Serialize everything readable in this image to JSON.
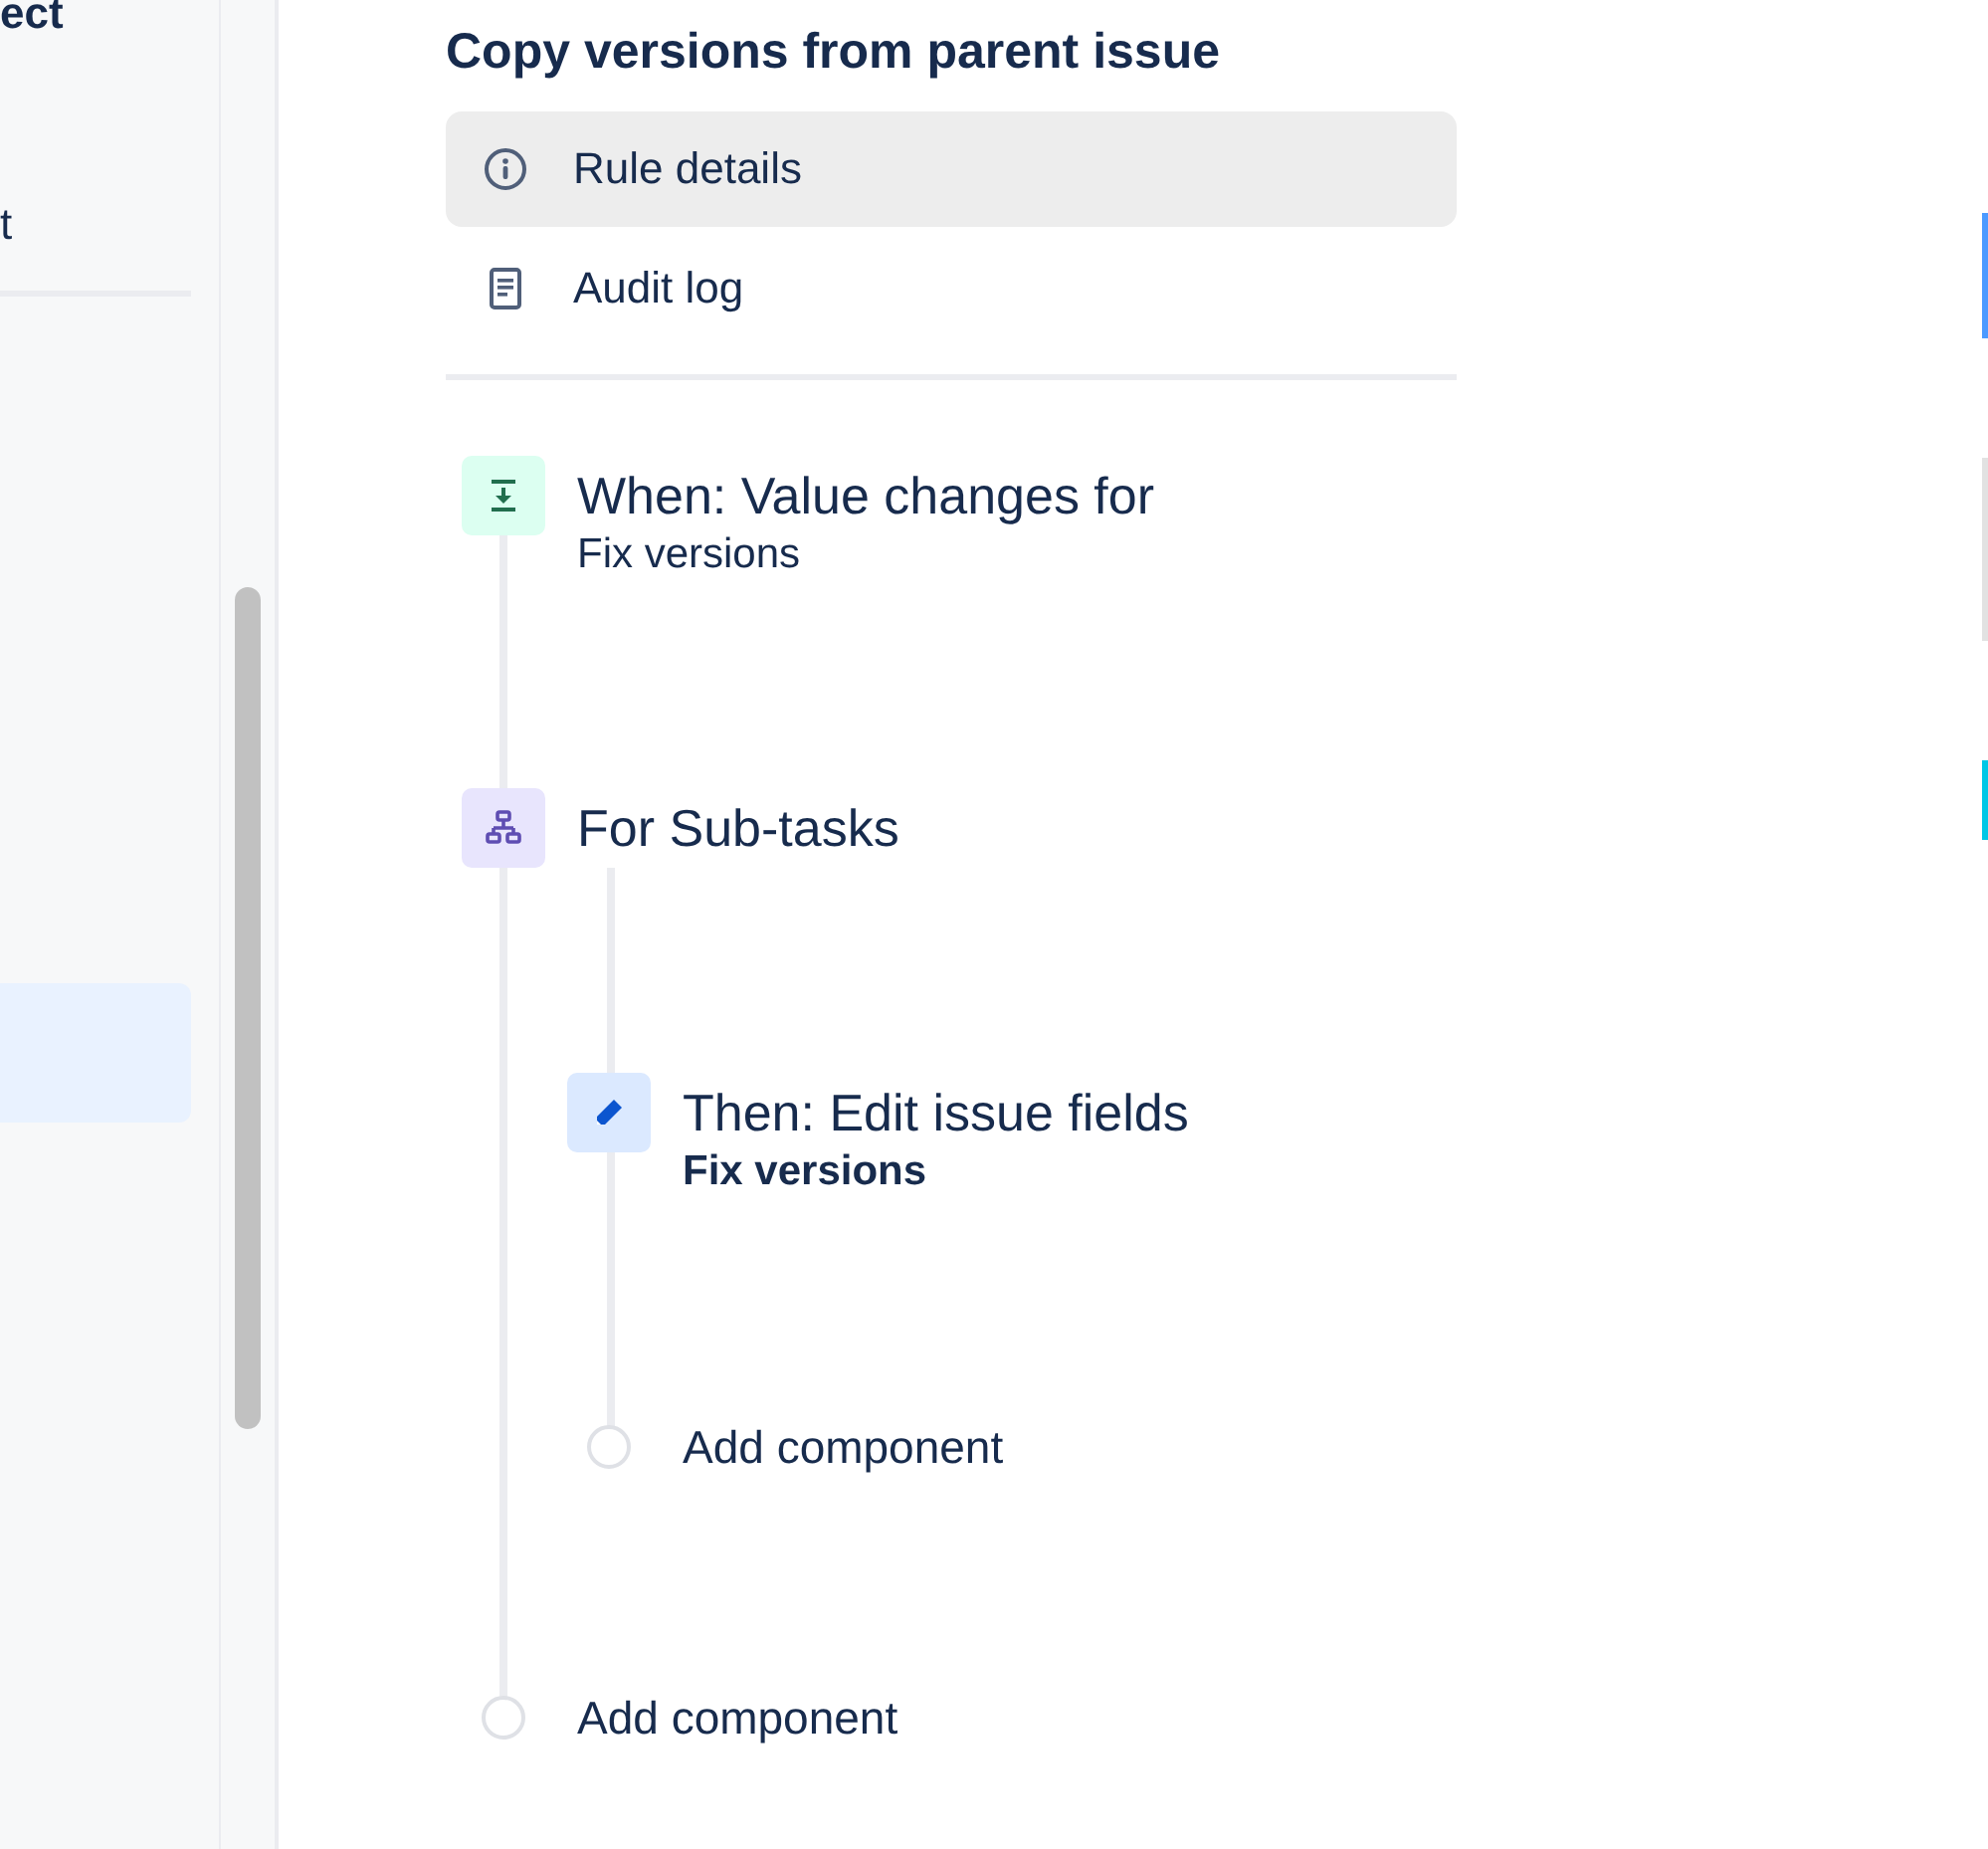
{
  "sidebar": {
    "items": [
      {
        "label": "ect",
        "kind": "heading"
      },
      {
        "label": "t",
        "kind": "link"
      }
    ]
  },
  "rule": {
    "title": "Copy versions from parent issue",
    "nav": [
      {
        "label": "Rule details",
        "kind": "info",
        "selected": true
      },
      {
        "label": "Audit log",
        "kind": "log",
        "selected": false
      }
    ],
    "components": [
      {
        "kind": "trigger",
        "title": "When: Value changes for",
        "subtitle": "Fix versions"
      },
      {
        "kind": "branch",
        "title": "For Sub-tasks",
        "children": [
          {
            "kind": "action",
            "title": "Then: Edit issue fields",
            "subtitle": "Fix versions"
          },
          {
            "kind": "add",
            "title": "Add component"
          }
        ]
      },
      {
        "kind": "add",
        "title": "Add component"
      }
    ]
  }
}
